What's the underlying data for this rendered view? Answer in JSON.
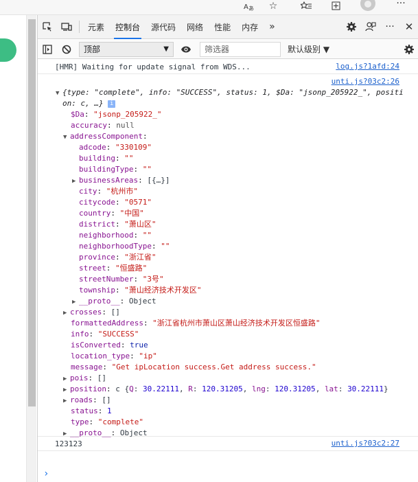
{
  "browser": {
    "icons": [
      "translate-icon",
      "star-icon",
      "favorites-icon",
      "collections-icon",
      "profile-icon",
      "more-icon"
    ]
  },
  "devtools": {
    "tabs": [
      {
        "label": "元素"
      },
      {
        "label": "控制台",
        "active": true
      },
      {
        "label": "源代码"
      },
      {
        "label": "网络"
      },
      {
        "label": "性能"
      },
      {
        "label": "内存"
      }
    ],
    "more_tabs": "»",
    "toolbar": {
      "context": "顶部",
      "filter_placeholder": "筛选器",
      "levels": "默认级别 ▼"
    }
  },
  "console": {
    "hmr": {
      "text": "[HMR] Waiting for update signal from WDS...",
      "source": "log.js?1afd:24"
    },
    "obj_source": "unti.js?03c2:26",
    "summary1": "{type: \"complete\", info: \"SUCCESS\", status: 1, $Da: \"jsonp_205922_\", positi",
    "summary2": "on: c, …}",
    "info_badge": "i",
    "root_props": {
      "Da_key": "$Da",
      "Da_val": "\"jsonp_205922_\"",
      "accuracy_key": "accuracy",
      "accuracy_val": "null",
      "addressComponent_key": "addressComponent"
    },
    "address": [
      {
        "key": "adcode",
        "val": "\"330109\""
      },
      {
        "key": "building",
        "val": "\"\""
      },
      {
        "key": "buildingType",
        "val": "\"\""
      },
      {
        "key": "businessAreas",
        "val": "[{…}]"
      },
      {
        "key": "city",
        "val": "\"杭州市\""
      },
      {
        "key": "citycode",
        "val": "\"0571\""
      },
      {
        "key": "country",
        "val": "\"中国\""
      },
      {
        "key": "district",
        "val": "\"萧山区\""
      },
      {
        "key": "neighborhood",
        "val": "\"\""
      },
      {
        "key": "neighborhoodType",
        "val": "\"\""
      },
      {
        "key": "province",
        "val": "\"浙江省\""
      },
      {
        "key": "street",
        "val": "\"恒盛路\""
      },
      {
        "key": "streetNumber",
        "val": "\"3号\""
      },
      {
        "key": "township",
        "val": "\"萧山经济技术开发区\""
      },
      {
        "key": "__proto__",
        "val": "Object"
      }
    ],
    "rest": [
      {
        "key": "crosses",
        "val": "[]"
      },
      {
        "key": "formattedAddress",
        "val": "\"浙江省杭州市萧山区萧山经济技术开发区恒盛路\""
      },
      {
        "key": "info",
        "val": "\"SUCCESS\""
      },
      {
        "key": "isConverted",
        "val": "true"
      },
      {
        "key": "location_type",
        "val": "\"ip\""
      },
      {
        "key": "message",
        "val": "\"Get ipLocation success.Get address success.\""
      },
      {
        "key": "pois",
        "val": "[]"
      },
      {
        "key": "position",
        "val": "c {Q: 30.22111, R: 120.31205, lng: 120.31205, lat: 30.22111}"
      },
      {
        "key": "roads",
        "val": "[]"
      },
      {
        "key": "status",
        "val": "1"
      },
      {
        "key": "type",
        "val": "\"complete\""
      },
      {
        "key": "__proto__",
        "val": "Object"
      }
    ],
    "log2": {
      "text": "123123",
      "source": "unti.js?03c2:27"
    },
    "prompt": "›"
  }
}
